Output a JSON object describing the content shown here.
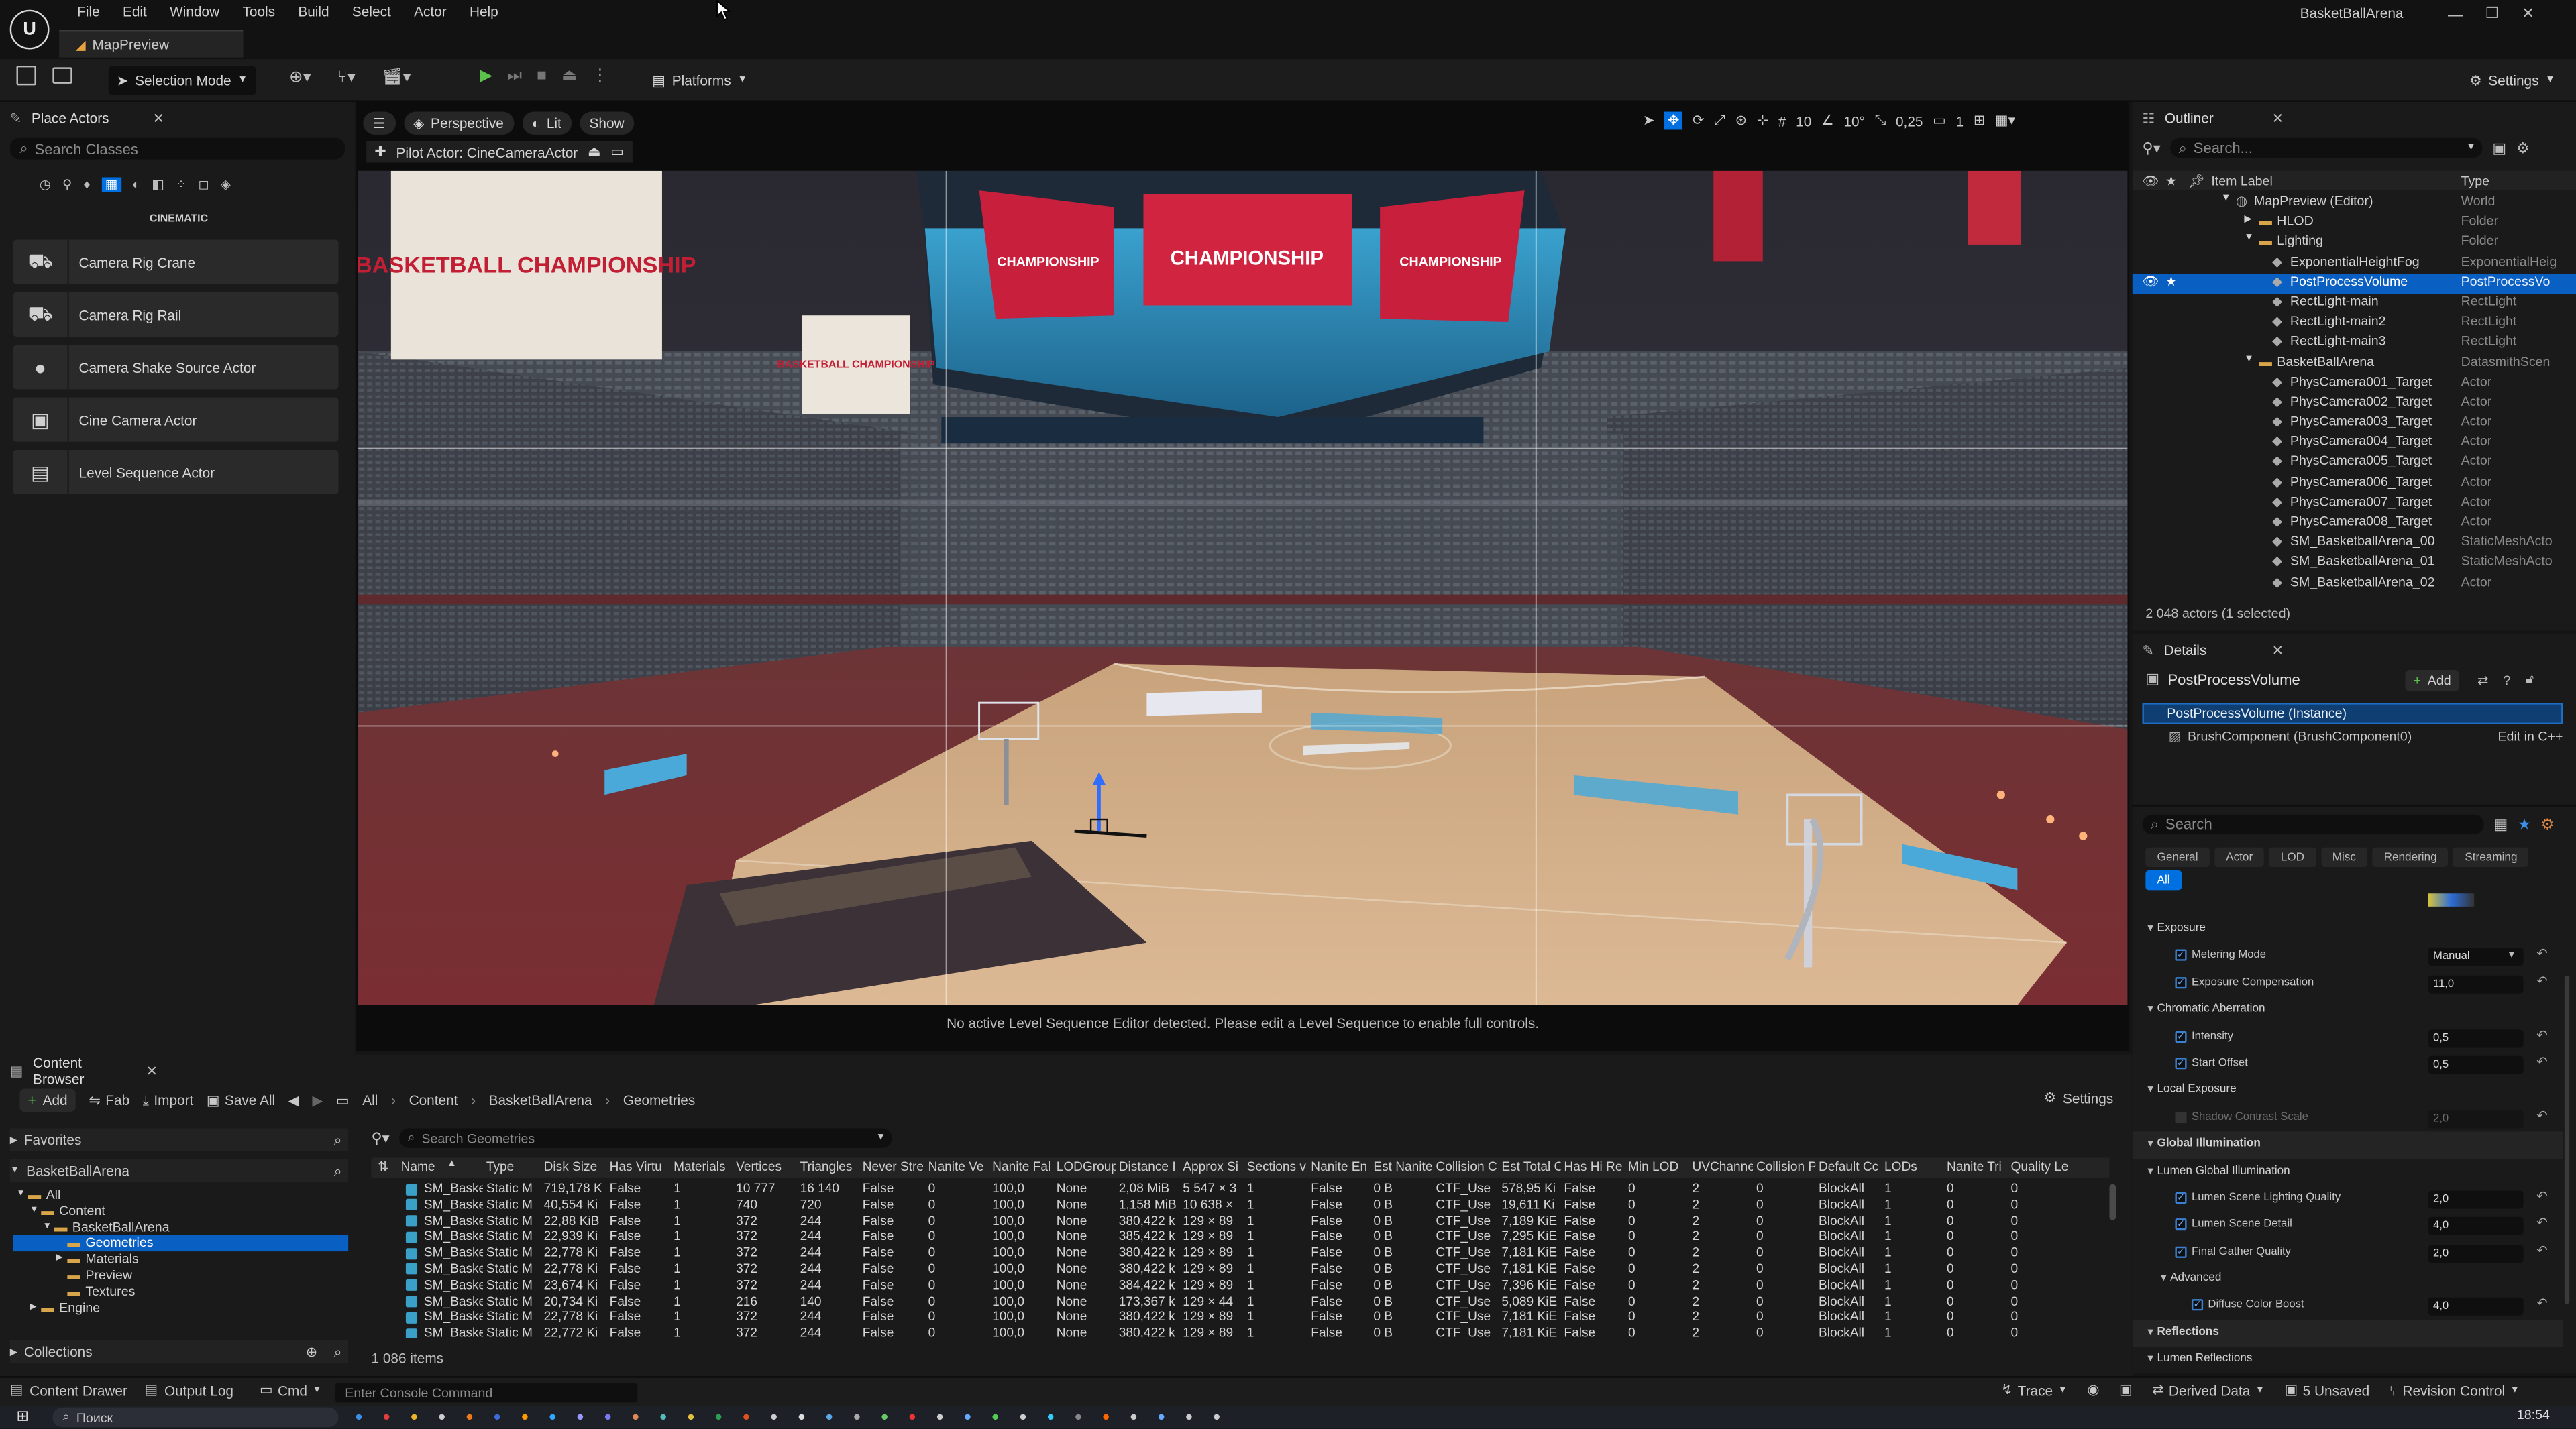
{
  "window": {
    "title": "BasketBallArena",
    "document_tab": "MapPreview",
    "menu": [
      "File",
      "Edit",
      "Window",
      "Tools",
      "Build",
      "Select",
      "Actor",
      "Help"
    ]
  },
  "toolbar": {
    "selection_mode": "Selection Mode",
    "platforms": "Platforms",
    "settings": "Settings"
  },
  "place_actors": {
    "tab": "Place Actors",
    "search_placeholder": "Search Classes",
    "category": "CINEMATIC",
    "items": [
      "Camera Rig Crane",
      "Camera Rig Rail",
      "Camera Shake Source Actor",
      "Cine Camera Actor",
      "Level Sequence Actor"
    ]
  },
  "viewport": {
    "perspective": "Perspective",
    "lit": "Lit",
    "show": "Show",
    "pilot": "Pilot Actor: CineCameraActor",
    "grid": "10",
    "angle": "10°",
    "scale": "0,25",
    "cam_speed": "1",
    "message": "No active Level Sequence Editor detected. Please edit a Level Sequence to enable full controls.",
    "banners": [
      "BASKETBALL CHAMPIONSHIP",
      "BASKETBALL CHAMPIONSHIP",
      "CHAMPIONSHIP",
      "CHAMPIONSHIP",
      "CHAMPIONSHIP"
    ]
  },
  "outliner": {
    "tab": "Outliner",
    "search_placeholder": "Search...",
    "col_label": "Item Label",
    "col_type": "Type",
    "rows": [
      {
        "label": "MapPreview (Editor)",
        "type": "World"
      },
      {
        "label": "HLOD",
        "type": "Folder"
      },
      {
        "label": "Lighting",
        "type": "Folder"
      },
      {
        "label": "ExponentialHeightFog",
        "type": "ExponentialHeig"
      },
      {
        "label": "PostProcessVolume",
        "type": "PostProcessVo"
      },
      {
        "label": "RectLight-main",
        "type": "RectLight"
      },
      {
        "label": "RectLight-main2",
        "type": "RectLight"
      },
      {
        "label": "RectLight-main3",
        "type": "RectLight"
      },
      {
        "label": "BasketBallArena",
        "type": "DatasmithScen"
      },
      {
        "label": "PhysCamera001_Target",
        "type": "Actor"
      },
      {
        "label": "PhysCamera002_Target",
        "type": "Actor"
      },
      {
        "label": "PhysCamera003_Target",
        "type": "Actor"
      },
      {
        "label": "PhysCamera004_Target",
        "type": "Actor"
      },
      {
        "label": "PhysCamera005_Target",
        "type": "Actor"
      },
      {
        "label": "PhysCamera006_Target",
        "type": "Actor"
      },
      {
        "label": "PhysCamera007_Target",
        "type": "Actor"
      },
      {
        "label": "PhysCamera008_Target",
        "type": "Actor"
      },
      {
        "label": "SM_BasketballArena_00",
        "type": "StaticMeshActo"
      },
      {
        "label": "SM_BasketballArena_01",
        "type": "StaticMeshActo"
      },
      {
        "label": "SM_BasketballArena_02",
        "type": "Actor"
      }
    ],
    "footer": "2 048 actors (1 selected)"
  },
  "details": {
    "tab": "Details",
    "object": "PostProcessVolume",
    "add": "Add",
    "instance": "PostProcessVolume (Instance)",
    "component": "BrushComponent (BrushComponent0)",
    "edit_cpp": "Edit in C++",
    "search_placeholder": "Search",
    "filters": [
      "General",
      "Actor",
      "LOD",
      "Misc",
      "Rendering",
      "Streaming",
      "All"
    ],
    "rows": [
      {
        "kind": "cat",
        "label": "Exposure"
      },
      {
        "kind": "prop",
        "label": "Metering Mode",
        "value": "Manual"
      },
      {
        "kind": "prop",
        "label": "Exposure Compensation",
        "value": "11,0"
      },
      {
        "kind": "cat",
        "label": "Chromatic Aberration"
      },
      {
        "kind": "prop",
        "label": "Intensity",
        "value": "0,5"
      },
      {
        "kind": "prop",
        "label": "Start Offset",
        "value": "0,5"
      },
      {
        "kind": "cat",
        "label": "Local Exposure"
      },
      {
        "kind": "prop-dim",
        "label": "Shadow Contrast Scale",
        "value": "2,0"
      },
      {
        "kind": "section",
        "label": "Global Illumination"
      },
      {
        "kind": "cat",
        "label": "Lumen Global Illumination"
      },
      {
        "kind": "prop",
        "label": "Lumen Scene Lighting Quality",
        "value": "2,0"
      },
      {
        "kind": "prop",
        "label": "Lumen Scene Detail",
        "value": "4,0"
      },
      {
        "kind": "prop",
        "label": "Final Gather Quality",
        "value": "2,0"
      },
      {
        "kind": "cat2",
        "label": "Advanced"
      },
      {
        "kind": "prop2",
        "label": "Diffuse Color Boost",
        "value": "4,0"
      },
      {
        "kind": "section",
        "label": "Reflections"
      },
      {
        "kind": "cat",
        "label": "Lumen Reflections"
      }
    ]
  },
  "content_browser": {
    "tab": "Content Browser",
    "add": "Add",
    "fab": "Fab",
    "import": "Import",
    "save_all": "Save All",
    "breadcrumb": [
      "All",
      "Content",
      "BasketBallArena",
      "Geometries"
    ],
    "settings": "Settings",
    "favorites": "Favorites",
    "root": "BasketBallArena",
    "tree": [
      "All",
      "Content",
      "BasketBallArena",
      "Geometries",
      "Materials",
      "Preview",
      "Textures",
      "Engine"
    ],
    "collections": "Collections",
    "search_placeholder": "Search Geometries",
    "columns": [
      "Name",
      "Type",
      "Disk Size",
      "Has Virtu",
      "Materials",
      "Vertices",
      "Triangles",
      "Never Stre",
      "Nanite Ve",
      "Nanite Fal",
      "LODGroup",
      "Distance I",
      "Approx Si",
      "Sections v",
      "Nanite En",
      "Est Nanite",
      "Collision C",
      "Est Total C",
      "Has Hi Re",
      "Min LOD",
      "UVChanne",
      "Collision P",
      "Default Cc",
      "LODs",
      "Nanite Tri",
      "Quality Le"
    ],
    "rows": [
      [
        "SM_Basketba",
        "Static M",
        "719,178 K",
        "False",
        "1",
        "10 777",
        "16 140",
        "False",
        "0",
        "100,0",
        "None",
        "2,08 MiB",
        "5 547 × 3",
        "1",
        "False",
        "0 B",
        "CTF_Use",
        "578,95 Ki",
        "False",
        "0",
        "2",
        "0",
        "BlockAll",
        "1",
        "0",
        "0"
      ],
      [
        "SM_Basketba",
        "Static M",
        "40,554 Ki",
        "False",
        "1",
        "740",
        "720",
        "False",
        "0",
        "100,0",
        "None",
        "1,158 MiB",
        "10 638 ×",
        "1",
        "False",
        "0 B",
        "CTF_Use",
        "19,611 Ki",
        "False",
        "0",
        "2",
        "0",
        "BlockAll",
        "1",
        "0",
        "0"
      ],
      [
        "SM_Basketba",
        "Static M",
        "22,88 KiB",
        "False",
        "1",
        "372",
        "244",
        "False",
        "0",
        "100,0",
        "None",
        "380,422 k",
        "129 × 89",
        "1",
        "False",
        "0 B",
        "CTF_Use",
        "7,189 KiE",
        "False",
        "0",
        "2",
        "0",
        "BlockAll",
        "1",
        "0",
        "0"
      ],
      [
        "SM_Basketba",
        "Static M",
        "22,939 Ki",
        "False",
        "1",
        "372",
        "244",
        "False",
        "0",
        "100,0",
        "None",
        "385,422 k",
        "129 × 89",
        "1",
        "False",
        "0 B",
        "CTF_Use",
        "7,295 KiE",
        "False",
        "0",
        "2",
        "0",
        "BlockAll",
        "1",
        "0",
        "0"
      ],
      [
        "SM_Basketba",
        "Static M",
        "22,778 Ki",
        "False",
        "1",
        "372",
        "244",
        "False",
        "0",
        "100,0",
        "None",
        "380,422 k",
        "129 × 89",
        "1",
        "False",
        "0 B",
        "CTF_Use",
        "7,181 KiE",
        "False",
        "0",
        "2",
        "0",
        "BlockAll",
        "1",
        "0",
        "0"
      ],
      [
        "SM_Basketba",
        "Static M",
        "22,778 Ki",
        "False",
        "1",
        "372",
        "244",
        "False",
        "0",
        "100,0",
        "None",
        "380,422 k",
        "129 × 89",
        "1",
        "False",
        "0 B",
        "CTF_Use",
        "7,181 KiE",
        "False",
        "0",
        "2",
        "0",
        "BlockAll",
        "1",
        "0",
        "0"
      ],
      [
        "SM_Basketba",
        "Static M",
        "23,674 Ki",
        "False",
        "1",
        "372",
        "244",
        "False",
        "0",
        "100,0",
        "None",
        "384,422 k",
        "129 × 89",
        "1",
        "False",
        "0 B",
        "CTF_Use",
        "7,396 KiE",
        "False",
        "0",
        "2",
        "0",
        "BlockAll",
        "1",
        "0",
        "0"
      ],
      [
        "SM_Basketba",
        "Static M",
        "20,734 Ki",
        "False",
        "1",
        "216",
        "140",
        "False",
        "0",
        "100,0",
        "None",
        "173,367 k",
        "129 × 44",
        "1",
        "False",
        "0 B",
        "CTF_Use",
        "5,089 KiE",
        "False",
        "0",
        "2",
        "0",
        "BlockAll",
        "1",
        "0",
        "0"
      ],
      [
        "SM_Basketba",
        "Static M",
        "22,778 Ki",
        "False",
        "1",
        "372",
        "244",
        "False",
        "0",
        "100,0",
        "None",
        "380,422 k",
        "129 × 89",
        "1",
        "False",
        "0 B",
        "CTF_Use",
        "7,181 KiE",
        "False",
        "0",
        "2",
        "0",
        "BlockAll",
        "1",
        "0",
        "0"
      ],
      [
        "SM_Basketba",
        "Static M",
        "22,772 Ki",
        "False",
        "1",
        "372",
        "244",
        "False",
        "0",
        "100,0",
        "None",
        "380,422 k",
        "129 × 89",
        "1",
        "False",
        "0 B",
        "CTF_Use",
        "7,181 KiE",
        "False",
        "0",
        "2",
        "0",
        "BlockAll",
        "1",
        "0",
        "0"
      ]
    ],
    "item_count": "1 086 items"
  },
  "statusbar": {
    "content_drawer": "Content Drawer",
    "output_log": "Output Log",
    "cmd": "Cmd",
    "console_placeholder": "Enter Console Command",
    "trace": "Trace",
    "derived_data": "Derived Data",
    "unsaved": "5 Unsaved",
    "revision": "Revision Control"
  },
  "taskbar": {
    "search": "Поиск",
    "clock": "18:54"
  },
  "colors": {
    "accent": "#0070e0",
    "play_green": "#5cc24d",
    "selection": "#0a5fc2"
  }
}
